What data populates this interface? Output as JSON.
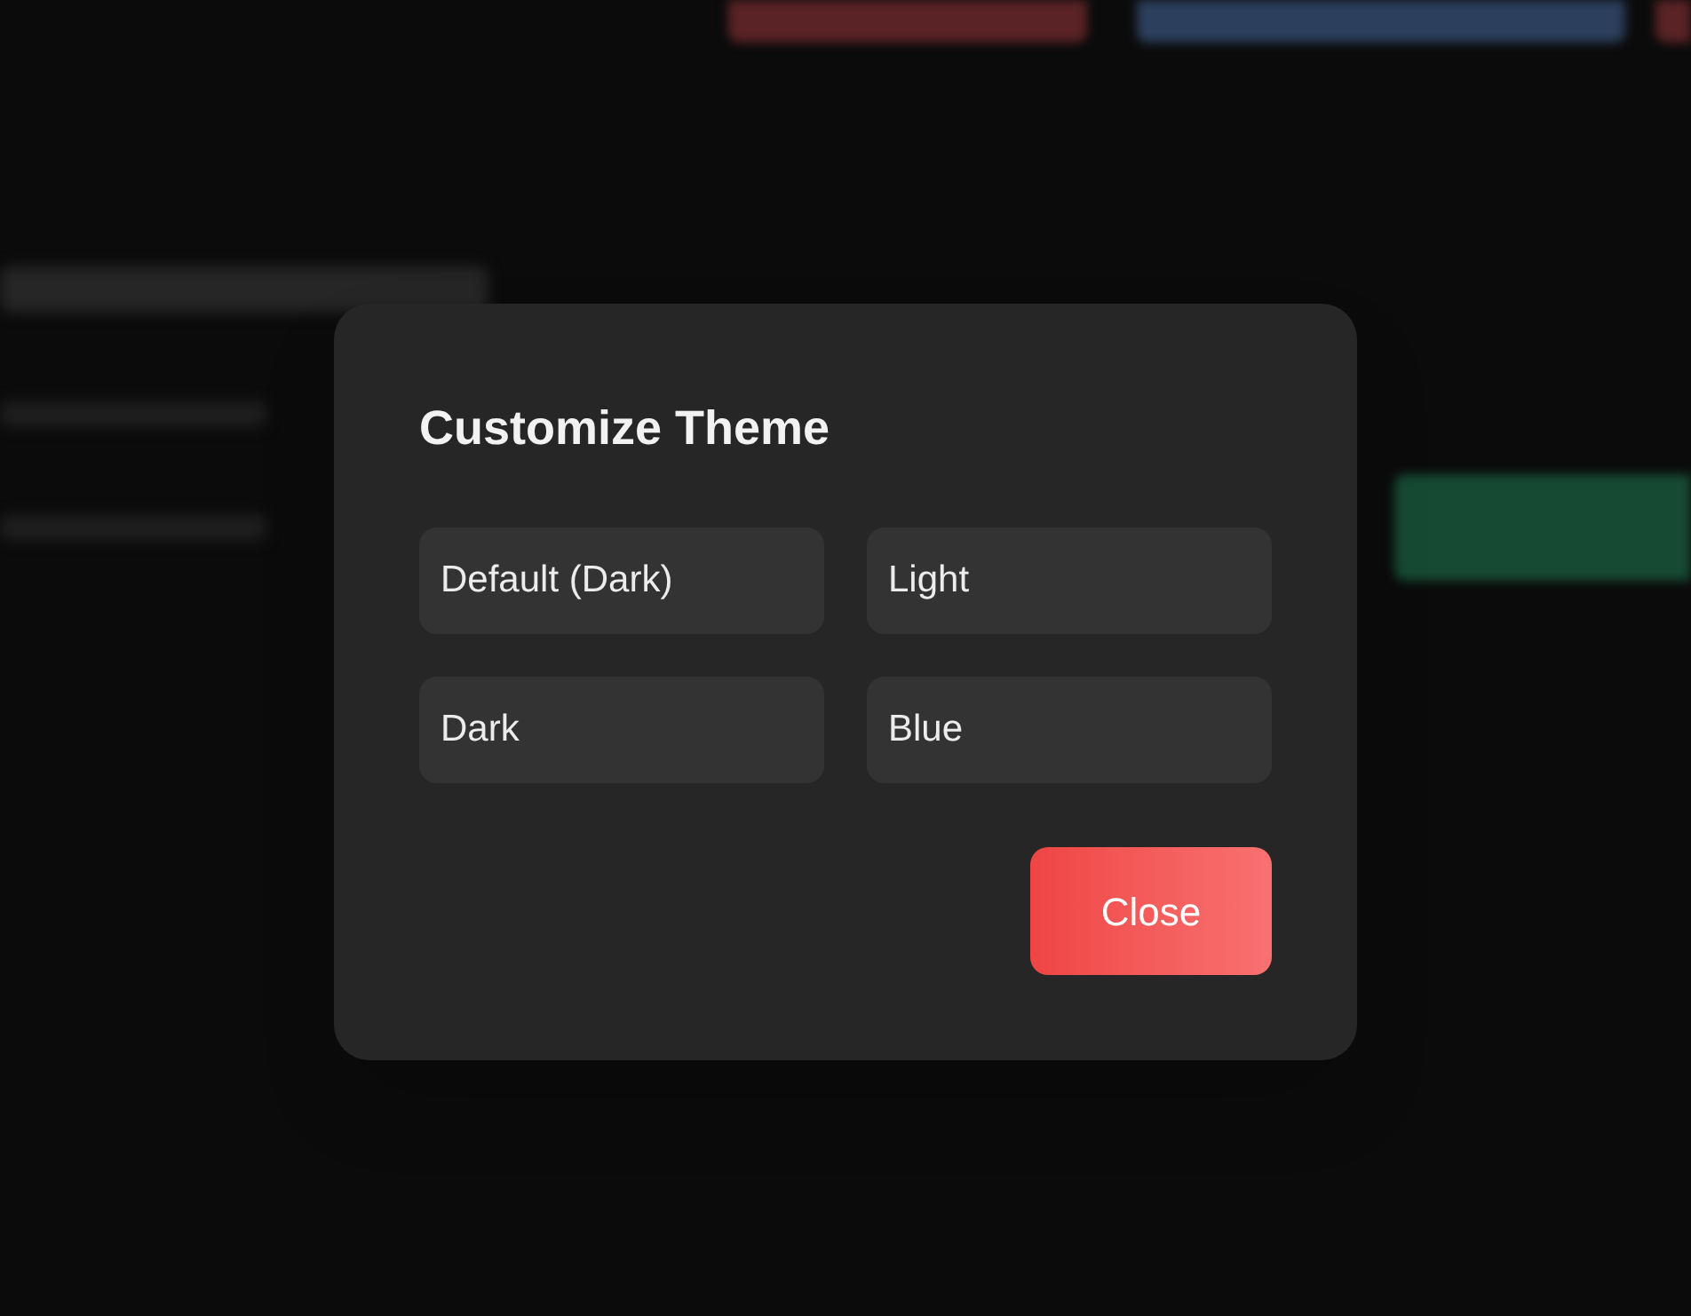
{
  "dialog": {
    "title": "Customize Theme",
    "options": [
      {
        "label": "Default (Dark)"
      },
      {
        "label": "Light"
      },
      {
        "label": "Dark"
      },
      {
        "label": "Blue"
      }
    ],
    "close_button": "Close"
  }
}
